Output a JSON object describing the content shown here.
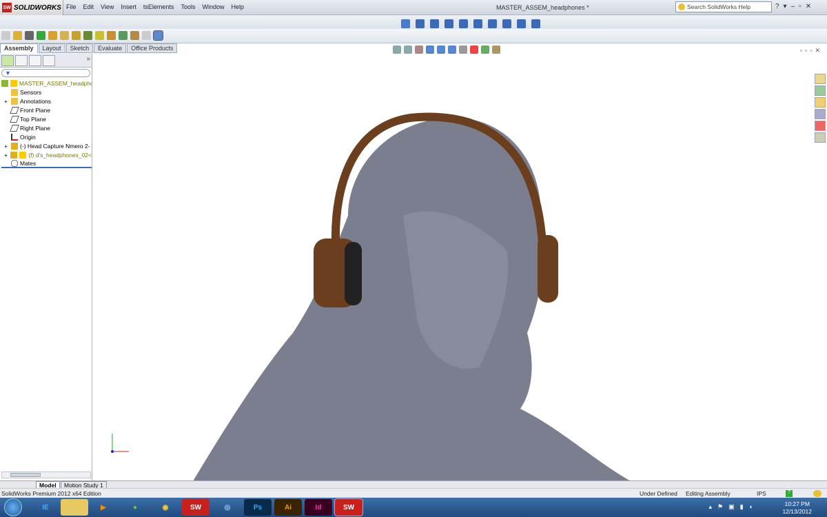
{
  "app": {
    "brand": "SOLIDWORKS",
    "title": "MASTER_ASSEM_headphones *"
  },
  "menu": [
    "File",
    "Edit",
    "View",
    "Insert",
    "tsElements",
    "Tools",
    "Window",
    "Help"
  ],
  "search": {
    "placeholder": "Search SolidWorks Help"
  },
  "cm_tabs": [
    "Assembly",
    "Layout",
    "Sketch",
    "Evaluate",
    "Office Products"
  ],
  "tree": {
    "root": "MASTER_ASSEM_headphon",
    "items": [
      "Sensors",
      "Annotations",
      "Front Plane",
      "Top Plane",
      "Right Plane",
      "Origin",
      "(-) Head Capture Nmero 2-",
      "(f) d's_headphones_02<",
      "Mates"
    ]
  },
  "bottom_tabs": [
    "Model",
    "Motion Study 1"
  ],
  "status": {
    "edition": "SolidWorks Premium 2012 x64 Edition",
    "state": "Under Defined",
    "mode": "Editing Assembly",
    "units": "IPS"
  },
  "taskbar": {
    "apps": [
      "IE",
      "Explorer",
      "Media",
      "Spotify",
      "Chrome",
      "SW",
      "Media2",
      "Ps",
      "Ai",
      "Id",
      "SW"
    ],
    "time": "10:27 PM",
    "date": "12/13/2012"
  },
  "colors": {
    "model": "#7a7e8e",
    "wood": "#6b3e1e",
    "accent": "#c8201c"
  }
}
